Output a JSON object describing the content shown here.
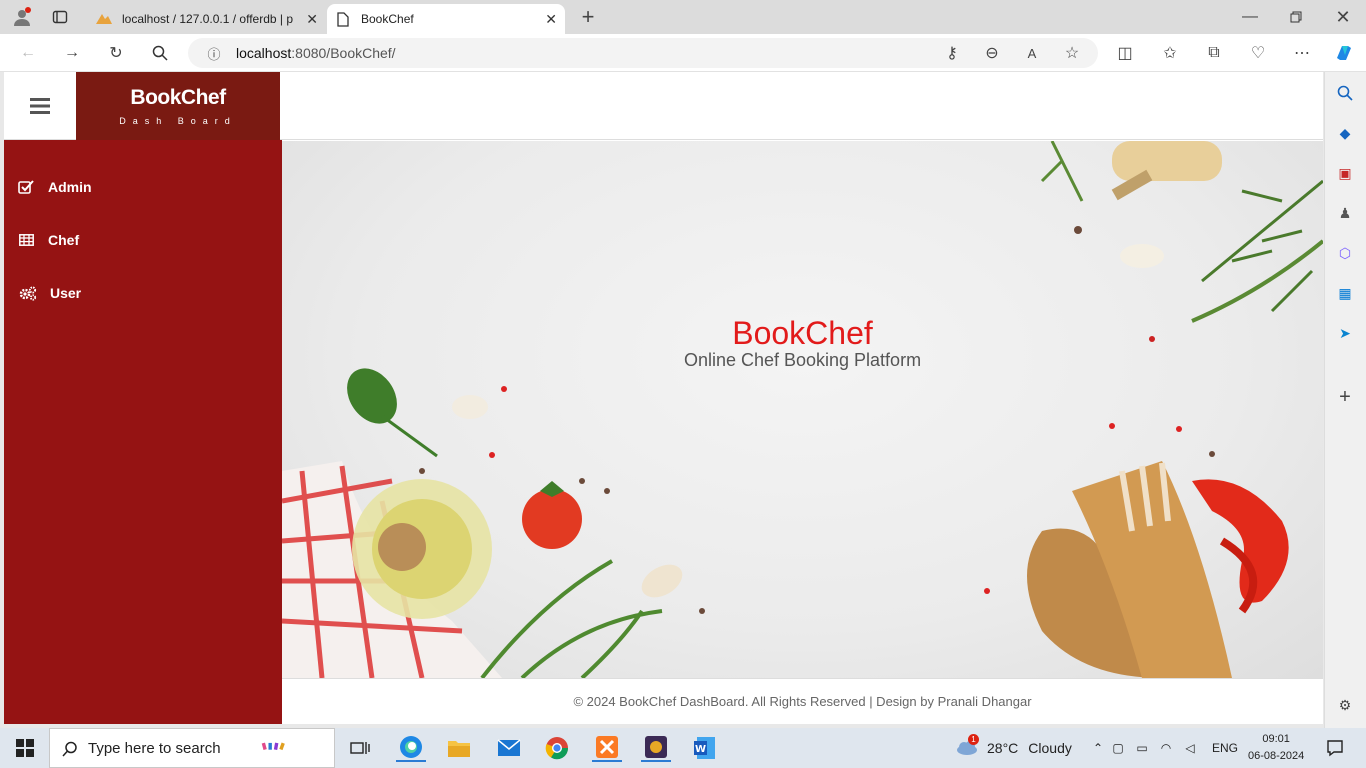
{
  "browser": {
    "tabs": [
      {
        "label": "localhost / 127.0.0.1 / offerdb | p"
      },
      {
        "label": "BookChef"
      }
    ],
    "url_host": "localhost",
    "url_path": ":8080/BookChef/"
  },
  "app": {
    "brand_title": "BookChef",
    "brand_subtitle": "Dash Board",
    "sidebar": [
      {
        "label": "Admin",
        "icon": "check-square-icon"
      },
      {
        "label": "Chef",
        "icon": "table-icon"
      },
      {
        "label": "User",
        "icon": "cogs-icon"
      }
    ],
    "hero_title": "BookChef",
    "hero_subtitle": "Online Chef Booking Platform",
    "footer": "© 2024 BookChef DashBoard. All Rights Reserved | Design by Pranali Dhangar",
    "colors": {
      "brand_dark": "#7a1a12",
      "sidebar": "#951313",
      "accent": "#e21b1b"
    }
  },
  "taskbar": {
    "search_placeholder": "Type here to search",
    "weather_temp": "28°C",
    "weather_text": "Cloudy",
    "weather_badge": "1",
    "lang": "ENG",
    "time": "09:01",
    "date": "06-08-2024"
  }
}
